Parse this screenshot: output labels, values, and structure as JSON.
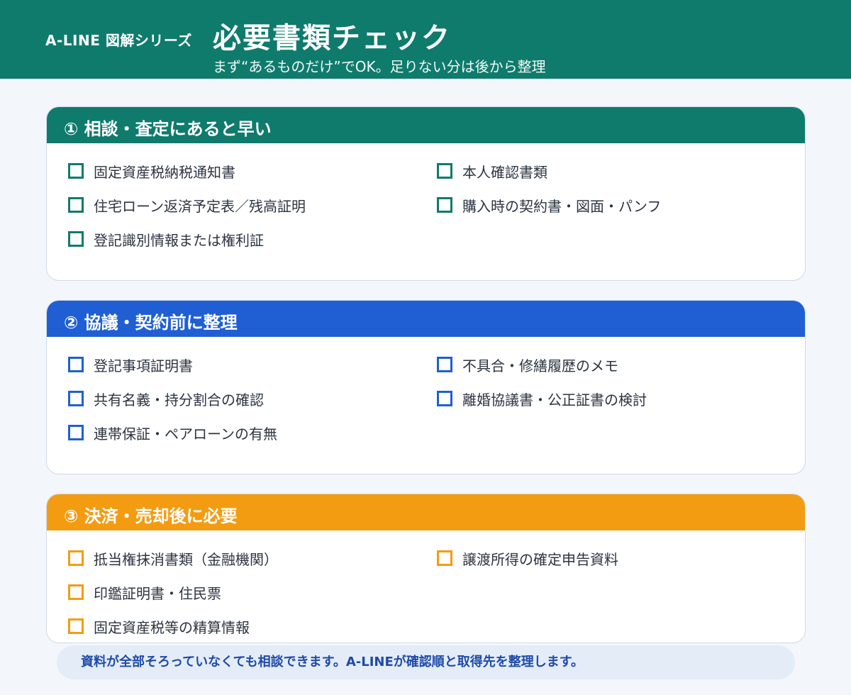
{
  "header": {
    "series": "A-LINE 図解シリーズ",
    "title": "必要書類チェック",
    "subtitle": "まず“あるものだけ”でOK。足りない分は後から整理",
    "background_color": "#0f7b6c"
  },
  "sections": [
    {
      "heading": "① 相談・査定にあると早い",
      "color": "#0f7b6c",
      "left_items": [
        "固定資産税納税通知書",
        "住宅ローン返済予定表／残高証明",
        "登記識別情報または権利証"
      ],
      "right_items": [
        "本人確認書類",
        "購入時の契約書・図面・パンフ"
      ]
    },
    {
      "heading": "② 協議・契約前に整理",
      "color": "#1f5fd3",
      "left_items": [
        "登記事項証明書",
        "共有名義・持分割合の確認",
        "連帯保証・ペアローンの有無"
      ],
      "right_items": [
        "不具合・修繕履歴のメモ",
        "離婚協議書・公正証書の検討"
      ]
    },
    {
      "heading": "③ 決済・売却後に必要",
      "color": "#f39c12",
      "left_items": [
        "抵当権抹消書類（金融機関）",
        "印鑑証明書・住民票",
        "固定資産税等の精算情報"
      ],
      "right_items": [
        "譲渡所得の確定申告資料"
      ]
    }
  ],
  "footer": {
    "text": "資料が全部そろっていなくても相談できます。A-LINEが確認順と取得先を整理します。"
  }
}
